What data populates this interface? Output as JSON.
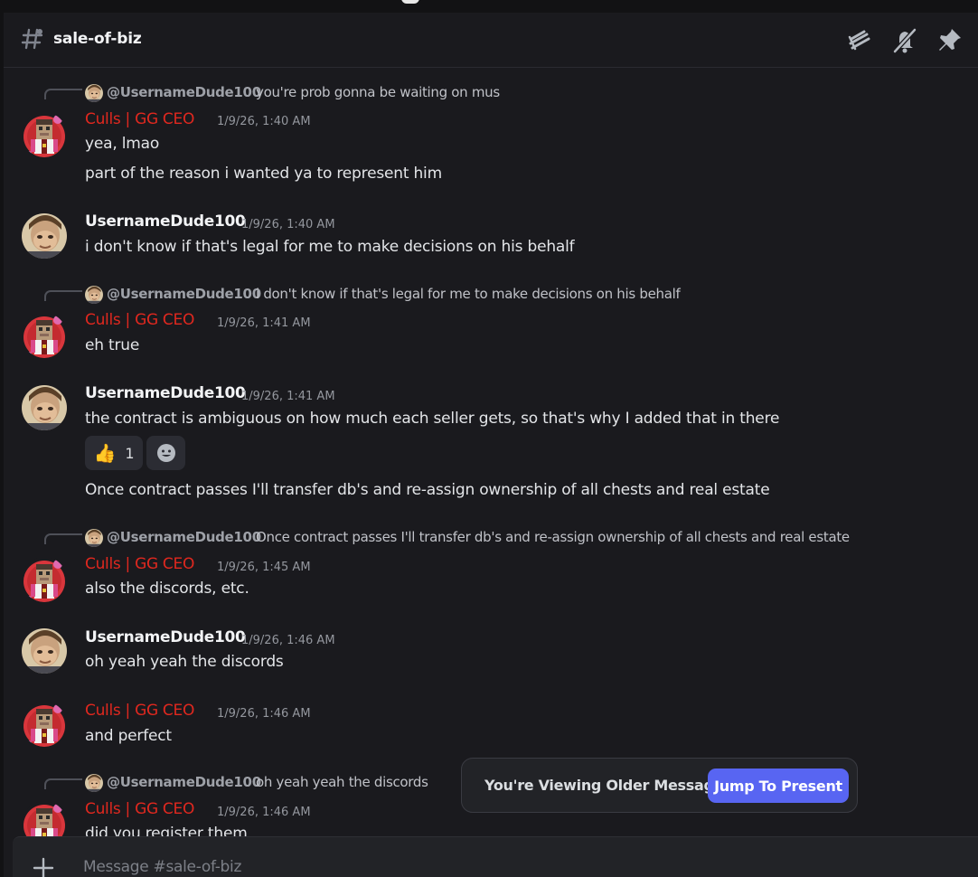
{
  "channel": {
    "name": "sale-of-biz",
    "composer_placeholder": "Message #sale-of-biz"
  },
  "header": {
    "icons": [
      "threads-icon",
      "mute-bell-icon",
      "pin-icon"
    ]
  },
  "colors": {
    "role_red": "#e0281f",
    "accent": "#5865f2",
    "background": "#1a1a1e"
  },
  "messages": [
    {
      "reply": {
        "author": "@UsernameDude100",
        "text": "you're prob gonna be waiting on mus"
      },
      "author": "Culls | GG CEO",
      "timestamp": "1/9/26, 1:40 AM",
      "lines": [
        "yea, lmao",
        "part of the reason i wanted ya to represent him"
      ]
    },
    {
      "author": "UsernameDude100",
      "timestamp": "1/9/26, 1:40 AM",
      "lines": [
        "i don't know if that's legal for me to make decisions on his behalf"
      ]
    },
    {
      "reply": {
        "author": "@UsernameDude100",
        "text": "i don't know if that's legal for me to make decisions on his behalf"
      },
      "author": "Culls | GG CEO",
      "timestamp": "1/9/26, 1:41 AM",
      "lines": [
        "eh true"
      ]
    },
    {
      "author": "UsernameDude100",
      "timestamp": "1/9/26, 1:41 AM",
      "lines": [
        "the contract is ambiguous on how much each seller gets, so that's why I added that in there",
        "Once contract passes I'll transfer db's and re-assign ownership of all chests and real estate"
      ],
      "reactions": [
        {
          "emoji": "👍",
          "count": "1"
        }
      ]
    },
    {
      "reply": {
        "author": "@UsernameDude100",
        "text": "Once contract passes I'll transfer db's and re-assign ownership of all chests and real estate"
      },
      "author": "Culls | GG CEO",
      "timestamp": "1/9/26, 1:45 AM",
      "lines": [
        "also the discords, etc."
      ]
    },
    {
      "author": "UsernameDude100",
      "timestamp": "1/9/26, 1:46 AM",
      "lines": [
        "oh yeah yeah the discords"
      ]
    },
    {
      "author": "Culls | GG CEO",
      "timestamp": "1/9/26, 1:46 AM",
      "lines": [
        "and perfect"
      ]
    },
    {
      "reply": {
        "author": "@UsernameDude100",
        "text": "oh yeah yeah the discords"
      },
      "author": "Culls | GG CEO",
      "timestamp": "1/9/26, 1:46 AM",
      "lines": [
        "did you register them"
      ]
    }
  ],
  "older_messages_bar": {
    "text": "You're Viewing Older Messages",
    "button_label": "Jump To Present"
  }
}
